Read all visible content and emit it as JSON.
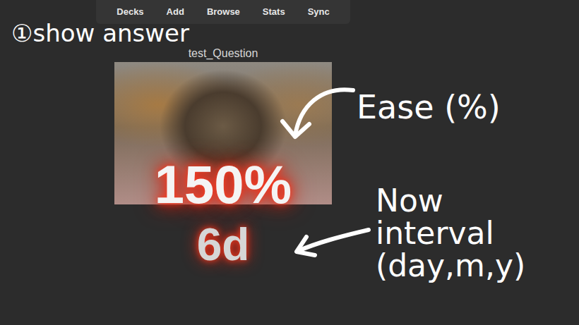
{
  "toolbar": {
    "items": [
      "Decks",
      "Add",
      "Browse",
      "Stats",
      "Sync"
    ]
  },
  "card": {
    "question": "test_Question",
    "ease": "150%",
    "interval": "6d"
  },
  "annotations": [
    {
      "text": "①show answer"
    },
    {
      "text": "Ease (%)"
    },
    {
      "text": "Now interval (day,m,y)"
    }
  ]
}
